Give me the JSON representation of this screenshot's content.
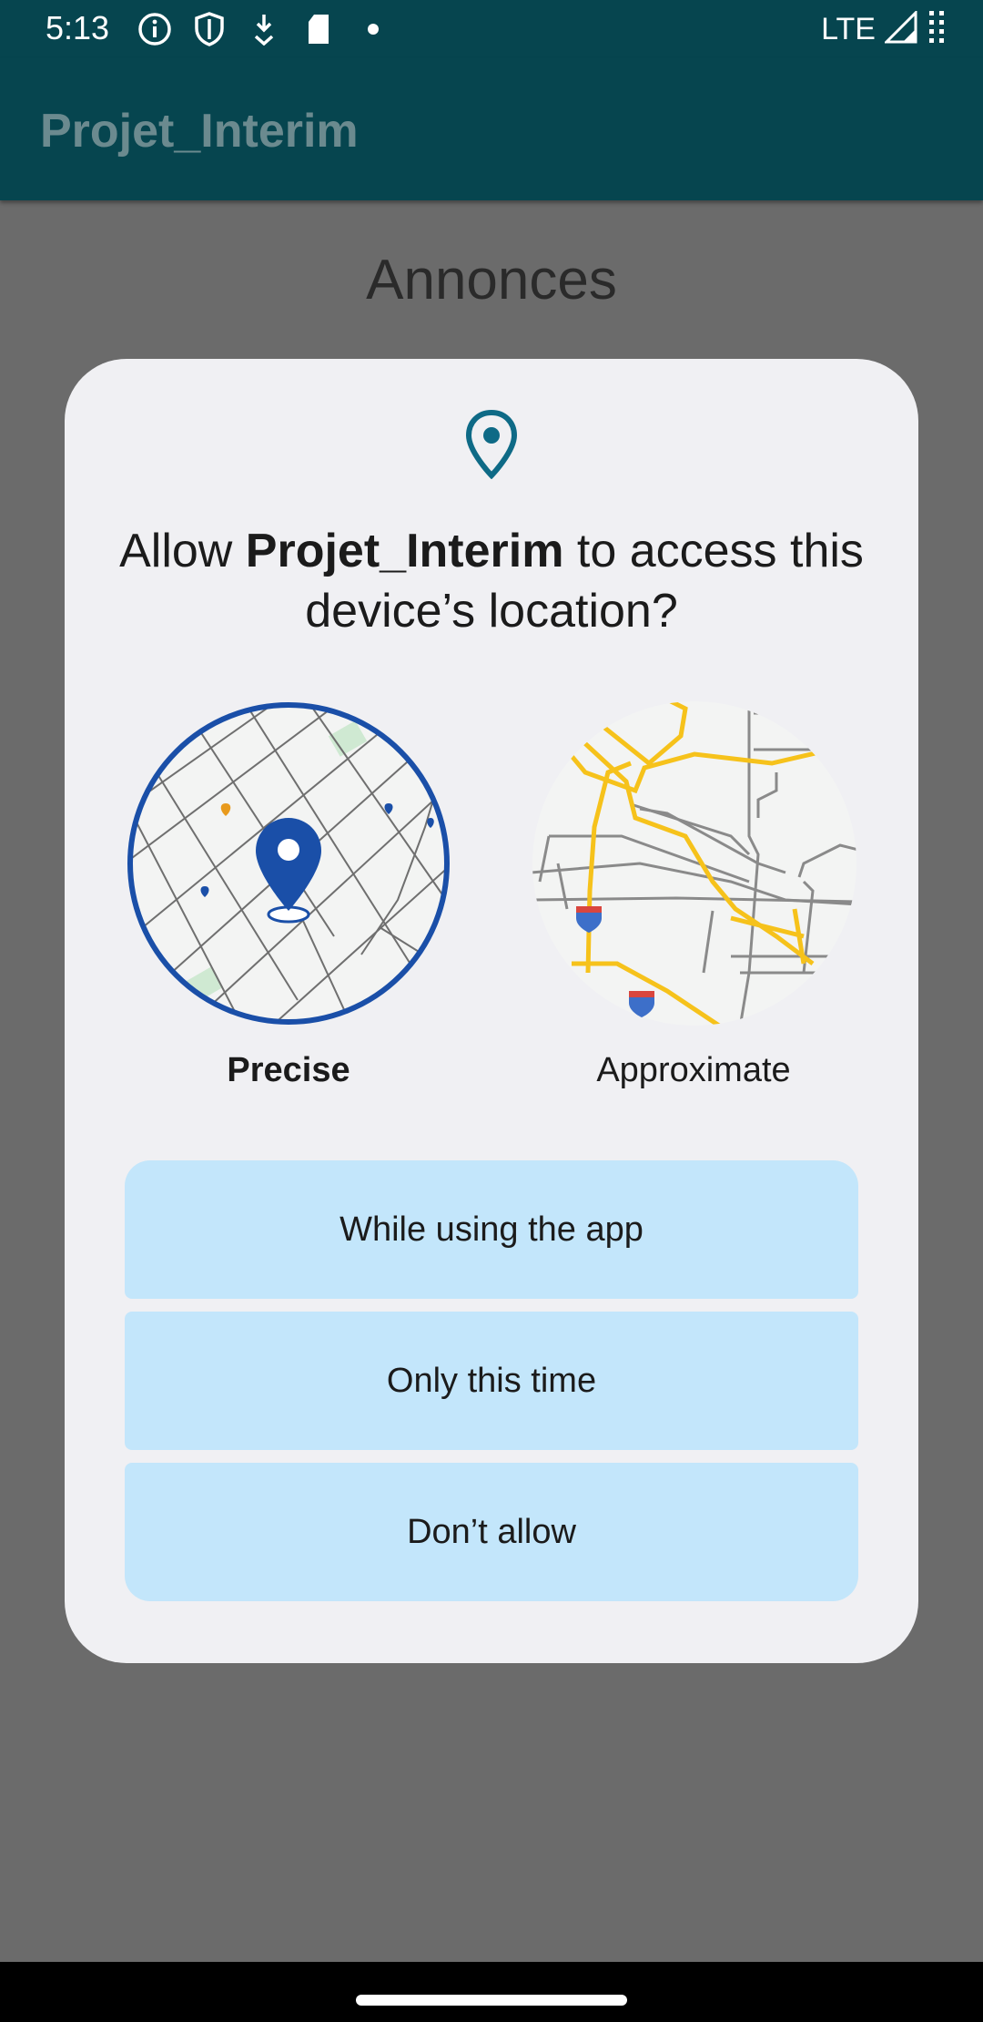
{
  "status_bar": {
    "time": "5:13",
    "network": "LTE",
    "icons": [
      "info-icon",
      "shield-icon",
      "download-icon",
      "sd-card-icon",
      "dot-icon",
      "signal-icon",
      "battery-icon"
    ]
  },
  "app_bar": {
    "title": "Projet_Interim"
  },
  "page": {
    "heading": "Annonces"
  },
  "dialog": {
    "icon": "location-pin-icon",
    "title_prefix": "Allow ",
    "app_name": "Projet_Interim",
    "title_suffix": " to access this device’s location?",
    "options": {
      "precise_label": "Precise",
      "approximate_label": "Approximate",
      "selected": "Precise"
    },
    "buttons": {
      "while_using": "While using the app",
      "only_this_time": "Only this time",
      "dont_allow": "Don’t allow"
    }
  },
  "colors": {
    "status_bar": "#06454f",
    "scrim": "#6b6b6b",
    "dialog_bg": "#f0f0f3",
    "button_bg": "#c3e6fb",
    "accent_blue": "#1a4fa8",
    "map_road_yellow": "#f6c21b"
  }
}
